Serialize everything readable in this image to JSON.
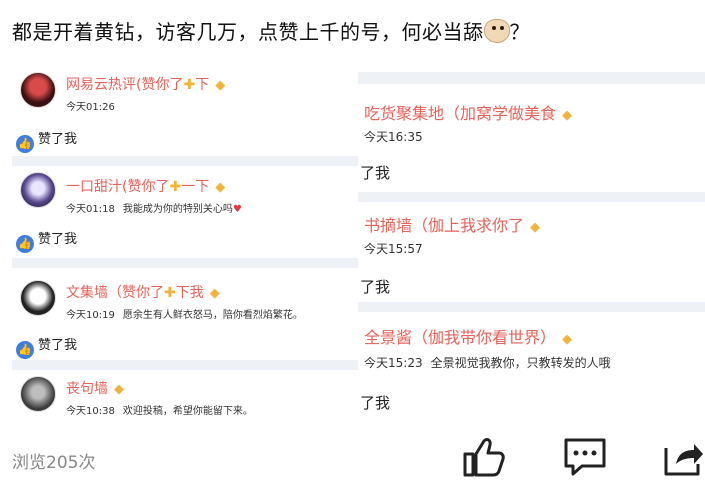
{
  "headline": "都是开着黄钻，访客几万，点赞上千的号，何必当舔",
  "headline_tail": "？",
  "headline_emoji": "dog-face-icon",
  "left_panel": {
    "items": [
      {
        "name": "网易云热评(赞你了",
        "name_tail": "下",
        "time": "今天01:26",
        "message": "",
        "like_label": "赞了我"
      },
      {
        "name": "一口甜汁(赞你了",
        "name_tail": "一下",
        "time": "今天01:18",
        "message": "我能成为你的特别关心吗",
        "like_label": "赞了我"
      },
      {
        "name": "文集墙（赞你了",
        "name_tail": "下我",
        "time": "今天10:19",
        "message": "愿余生有人鲜衣怒马，陪你看烈焰繁花。",
        "like_label": "赞了我"
      },
      {
        "name": "丧句墙",
        "name_tail": "",
        "time": "今天10:38",
        "message": "欢迎投稿，希望你能留下来。",
        "like_label": ""
      }
    ]
  },
  "right_panel": {
    "items": [
      {
        "name": "吃货聚集地（加窝学做美食",
        "time": "今天16:35",
        "message": "",
        "like_label": "了我"
      },
      {
        "name": "书摘墙（伽上我求你了",
        "time": "今天15:57",
        "message": "",
        "like_label": "了我"
      },
      {
        "name": "全景酱（伽我带你看世界）",
        "time": "今天15:23",
        "message": "全景视觉我教你，只教转发的人哦",
        "like_label": "了我"
      }
    ]
  },
  "footer": {
    "views": "浏览205次",
    "actions": [
      "thumbs-up-icon",
      "comment-icon",
      "share-icon"
    ]
  },
  "colors": {
    "name_red": "#e6635a",
    "like_blue": "#3d7fe0",
    "gold": "#f2b233"
  }
}
